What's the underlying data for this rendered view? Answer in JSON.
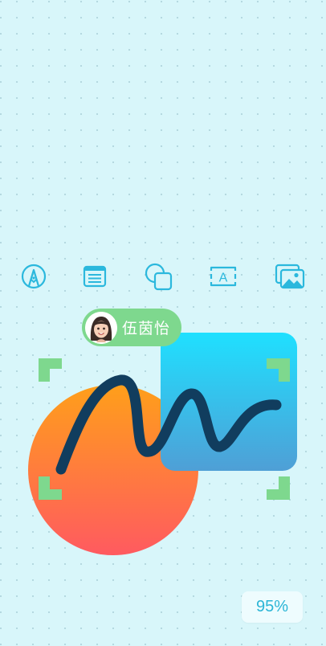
{
  "toolbar": {
    "tools": [
      {
        "id": "pen",
        "icon": "pen-nib-icon"
      },
      {
        "id": "sticky-note",
        "icon": "sticky-note-icon"
      },
      {
        "id": "shapes",
        "icon": "shapes-icon"
      },
      {
        "id": "text",
        "icon": "text-box-icon",
        "glyph": "A"
      },
      {
        "id": "image",
        "icon": "image-gallery-icon"
      }
    ],
    "accent_color": "#2bb8dd"
  },
  "collaborator": {
    "name": "伍茵怡",
    "avatar": "memoji-avatar",
    "tag_color": "#7ed88e"
  },
  "canvas": {
    "selection_color": "#7ed88e",
    "stroke_color": "#113d5e",
    "circle_gradient": [
      "#ff9f1a",
      "#ff5a60"
    ],
    "square_gradient": [
      "#1fe0ff",
      "#4f9fd6"
    ]
  },
  "zoom": {
    "label": "95%"
  }
}
